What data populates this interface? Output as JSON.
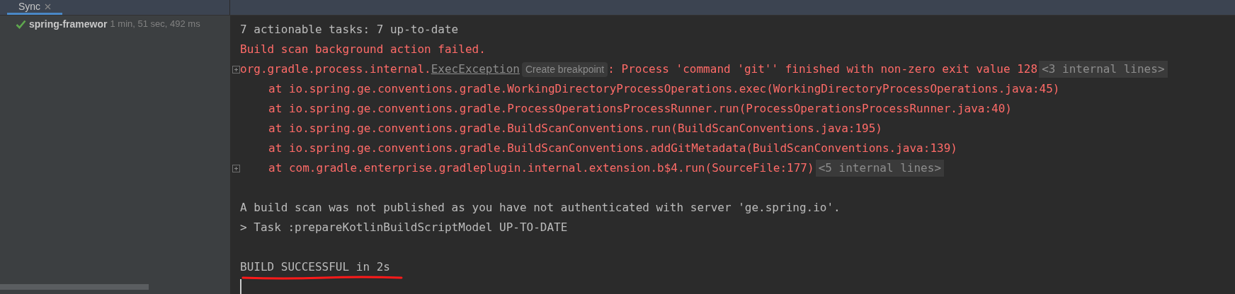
{
  "tabs": [
    {
      "label": "Sync",
      "selected": true,
      "closable": true
    }
  ],
  "tree": {
    "items": [
      {
        "kind": "success",
        "name": "spring-framewor",
        "duration": "1 min, 51 sec, 492 ms"
      }
    ]
  },
  "console": {
    "lines": [
      {
        "kind": "info",
        "text": "7 actionable tasks: 7 up-to-date"
      },
      {
        "kind": "error",
        "text": "Build scan background action failed."
      },
      {
        "kind": "exception",
        "foldable": true,
        "text": "org.gradle.process.internal.",
        "link": "ExecException",
        "hint": "Create breakpoint",
        "rest": ": Process 'command 'git'' finished with non-zero exit value 128",
        "folded": "<3 internal lines>"
      },
      {
        "kind": "stack",
        "text": "at io.spring.ge.conventions.gradle.WorkingDirectoryProcessOperations.exec(WorkingDirectoryProcessOperations.java:45)"
      },
      {
        "kind": "stack",
        "text": "at io.spring.ge.conventions.gradle.ProcessOperationsProcessRunner.run(ProcessOperationsProcessRunner.java:40)"
      },
      {
        "kind": "stack",
        "text": "at io.spring.ge.conventions.gradle.BuildScanConventions.run(BuildScanConventions.java:195)"
      },
      {
        "kind": "stack",
        "text": "at io.spring.ge.conventions.gradle.BuildScanConventions.addGitMetadata(BuildScanConventions.java:139)"
      },
      {
        "kind": "stack",
        "foldable": true,
        "text": "at com.gradle.enterprise.gradleplugin.internal.extension.b$4.run(SourceFile:177)",
        "folded": "<5 internal lines>"
      },
      {
        "kind": "blank"
      },
      {
        "kind": "info",
        "text": "A build scan was not published as you have not authenticated with server 'ge.spring.io'."
      },
      {
        "kind": "info",
        "text": "> Task :prepareKotlinBuildScriptModel UP-TO-DATE"
      },
      {
        "kind": "blank"
      },
      {
        "kind": "info",
        "text": "BUILD SUCCESSFUL in 2s",
        "underlined": true
      },
      {
        "kind": "cursor"
      }
    ]
  }
}
